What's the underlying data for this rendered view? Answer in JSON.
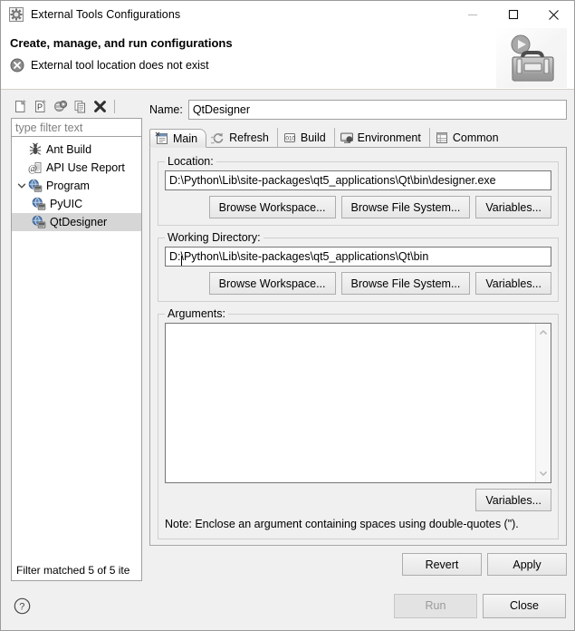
{
  "window": {
    "title": "External Tools Configurations",
    "icon": "external-tools-gear-icon",
    "minimize_label": "—",
    "maximize_label": "□",
    "close_label": "✕"
  },
  "banner": {
    "title": "Create, manage, and run configurations",
    "message": "External tool location does not exist",
    "message_icon": "error-circle-x-icon",
    "art_icon": "toolbox-run-icon"
  },
  "tree_toolbar": {
    "buttons": [
      {
        "name": "new-configuration-icon",
        "tooltip": "New launch configuration"
      },
      {
        "name": "new-prototype-icon",
        "tooltip": "New prototype"
      },
      {
        "name": "export-configuration-icon",
        "tooltip": "Export"
      },
      {
        "name": "duplicate-configuration-icon",
        "tooltip": "Duplicate"
      },
      {
        "name": "delete-configuration-icon",
        "tooltip": "Delete"
      }
    ]
  },
  "filter": {
    "placeholder": "type filter text",
    "value": ""
  },
  "tree": {
    "items": [
      {
        "label": "Ant Build",
        "icon": "ant-build-icon",
        "indent": 0,
        "expander": "none",
        "selected": false
      },
      {
        "label": "API Use Report",
        "icon": "api-use-report-icon",
        "indent": 0,
        "expander": "none",
        "selected": false
      },
      {
        "label": "Program",
        "icon": "program-icon",
        "indent": 0,
        "expander": "expanded",
        "selected": false
      },
      {
        "label": "PyUIC",
        "icon": "program-icon",
        "indent": 1,
        "expander": "none",
        "selected": false
      },
      {
        "label": "QtDesigner",
        "icon": "program-icon",
        "indent": 1,
        "expander": "none",
        "selected": true
      }
    ],
    "status": "Filter matched 5 of 5 ite"
  },
  "name_field": {
    "label": "Name:",
    "value": "QtDesigner"
  },
  "tabs": [
    {
      "label": "Main",
      "icon": "main-tab-icon",
      "active": true
    },
    {
      "label": "Refresh",
      "icon": "refresh-tab-icon",
      "active": false
    },
    {
      "label": "Build",
      "icon": "build-tab-icon",
      "active": false
    },
    {
      "label": "Environment",
      "icon": "environment-tab-icon",
      "active": false
    },
    {
      "label": "Common",
      "icon": "common-tab-icon",
      "active": false
    }
  ],
  "location_group": {
    "legend": "Location:",
    "value": "D:\\Python\\Lib\\site-packages\\qt5_applications\\Qt\\bin\\designer.exe",
    "buttons": {
      "browse_workspace": "Browse Workspace...",
      "browse_file_system": "Browse File System...",
      "variables": "Variables..."
    }
  },
  "working_directory_group": {
    "legend": "Working Directory:",
    "value_before_caret": "D:",
    "value_after_caret": "\\Python\\Lib\\site-packages\\qt5_applications\\Qt\\bin",
    "buttons": {
      "browse_workspace": "Browse Workspace...",
      "browse_file_system": "Browse File System...",
      "variables": "Variables..."
    }
  },
  "arguments_group": {
    "legend": "Arguments:",
    "value": "",
    "variables_button": "Variables...",
    "note": "Note: Enclose an argument containing spaces using double-quotes (\")."
  },
  "apply_row": {
    "revert": "Revert",
    "apply": "Apply"
  },
  "footer": {
    "help_icon": "help-question-icon",
    "run": "Run",
    "run_enabled": false,
    "close": "Close"
  },
  "colors": {
    "dialog_bg": "#f0f0f0",
    "header_bg": "#ffffff",
    "field_bg": "#ffffff",
    "selection_bg": "#d6d6d6",
    "border": "#a0a0a0",
    "disabled_text": "#9a9a9a",
    "placeholder_text": "#808080"
  }
}
